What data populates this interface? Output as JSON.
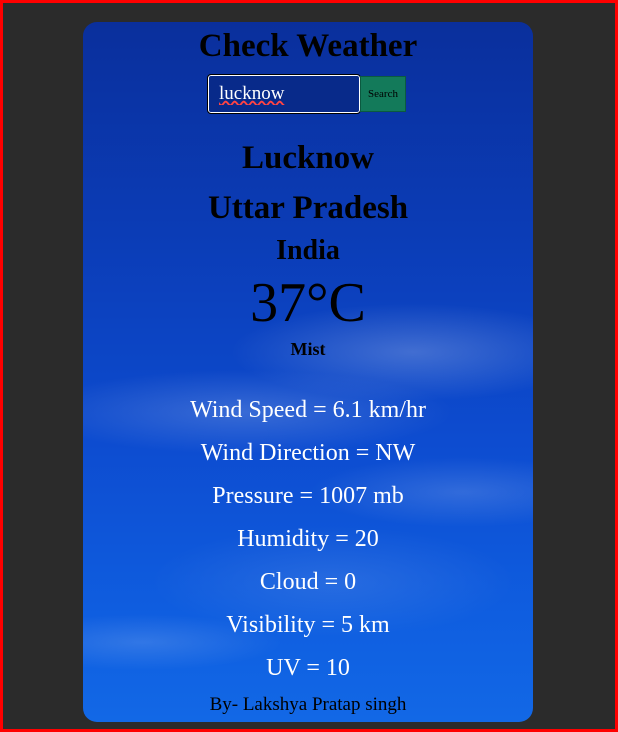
{
  "app": {
    "title": "Check Weather"
  },
  "search": {
    "value": "lucknow",
    "button_label": "Search"
  },
  "location": {
    "city": "Lucknow",
    "region": "Uttar Pradesh",
    "country": "India"
  },
  "current": {
    "temperature": "37°C",
    "condition": "Mist"
  },
  "stats": [
    "Wind Speed = 6.1 km/hr",
    "Wind Direction = NW",
    "Pressure = 1007 mb",
    "Humidity = 20",
    "Cloud = 0",
    "Visibility = 5 km",
    "UV = 10"
  ],
  "footer": {
    "author": "By- Lakshya Pratap singh"
  },
  "colors": {
    "page_background": "#2b2b2b",
    "frame_border": "#ff0000",
    "search_button": "#137a5a",
    "stat_text": "#ffffff"
  }
}
